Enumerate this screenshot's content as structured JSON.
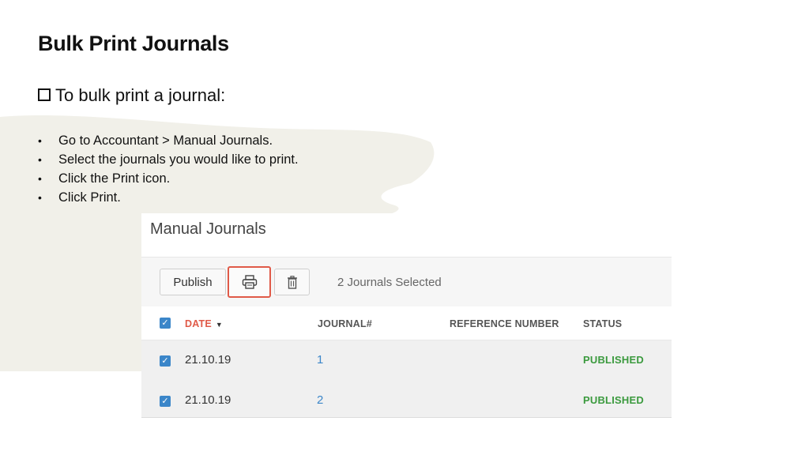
{
  "slide": {
    "title": "Bulk Print Journals",
    "subheading": "To bulk print a journal:",
    "bullets": [
      "Go to Accountant > Manual Journals.",
      "Select the journals you would like to print.",
      "Click the Print icon.",
      "Click Print."
    ],
    "bullet_char": "•"
  },
  "screenshot": {
    "title": "Manual Journals",
    "toolbar": {
      "publish_label": "Publish",
      "print_icon": "printer-icon",
      "delete_icon": "trash-icon",
      "selection_text": "2 Journals Selected",
      "highlight_color": "#e05a48"
    },
    "table": {
      "columns": [
        "DATE",
        "JOURNAL#",
        "REFERENCE NUMBER",
        "STATUS"
      ],
      "sort_indicator": "▼",
      "rows": [
        {
          "date": "21.10.19",
          "journal": "1",
          "reference": "",
          "status": "PUBLISHED",
          "checked": true
        },
        {
          "date": "21.10.19",
          "journal": "2",
          "reference": "",
          "status": "PUBLISHED",
          "checked": true
        }
      ]
    },
    "colors": {
      "accent": "#3b86c9",
      "status_published": "#3b9a3e",
      "sorted_column": "#e05a48"
    }
  }
}
